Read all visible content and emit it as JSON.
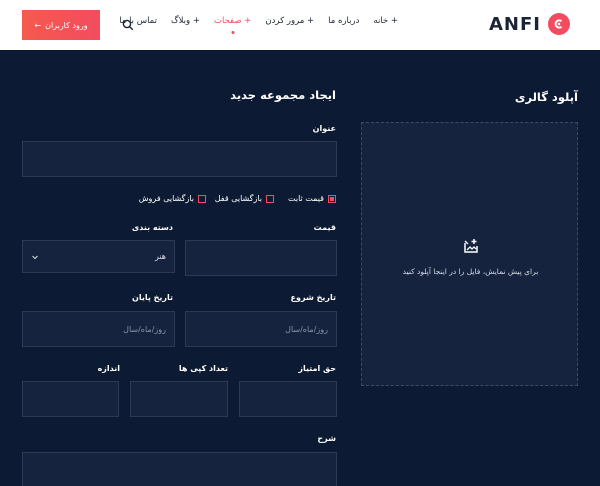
{
  "header": {
    "logo_text": "ANFI",
    "nav": [
      {
        "label": "خانه +",
        "active": false
      },
      {
        "label": "درباره ما",
        "active": false
      },
      {
        "label": "مرور کردن +",
        "active": false
      },
      {
        "label": "صفحات +",
        "active": true
      },
      {
        "label": "وبلاگ +",
        "active": false
      },
      {
        "label": "تماس با ما",
        "active": false
      }
    ],
    "login_label": "ورود کاربران",
    "login_arrow": "←"
  },
  "upload": {
    "title": "آپلود گالری",
    "hint": "برای پیش نمایش، فایل را در اینجا آپلود کنید"
  },
  "form": {
    "title": "ایجاد مجموعه جدید",
    "name_label": "عنوان",
    "options": [
      {
        "label": "قیمت ثابت",
        "checked": true
      },
      {
        "label": "بازگشایی قفل",
        "checked": false
      },
      {
        "label": "بازگشایی فروش",
        "checked": false
      }
    ],
    "price_label": "قیمت",
    "category_label": "دسته بندی",
    "category_value": "هنر",
    "start_label": "تاریخ شروع",
    "end_label": "تاریخ پایان",
    "date_placeholder": "روز/ماه/سال",
    "royalty_label": "حق امتیاز",
    "copies_label": "تعداد کپی ها",
    "size_label": "اندازه",
    "description_label": "شرح"
  },
  "colors": {
    "accent": "#f24c5e",
    "background": "#0d1a33",
    "field": "#15233f"
  }
}
